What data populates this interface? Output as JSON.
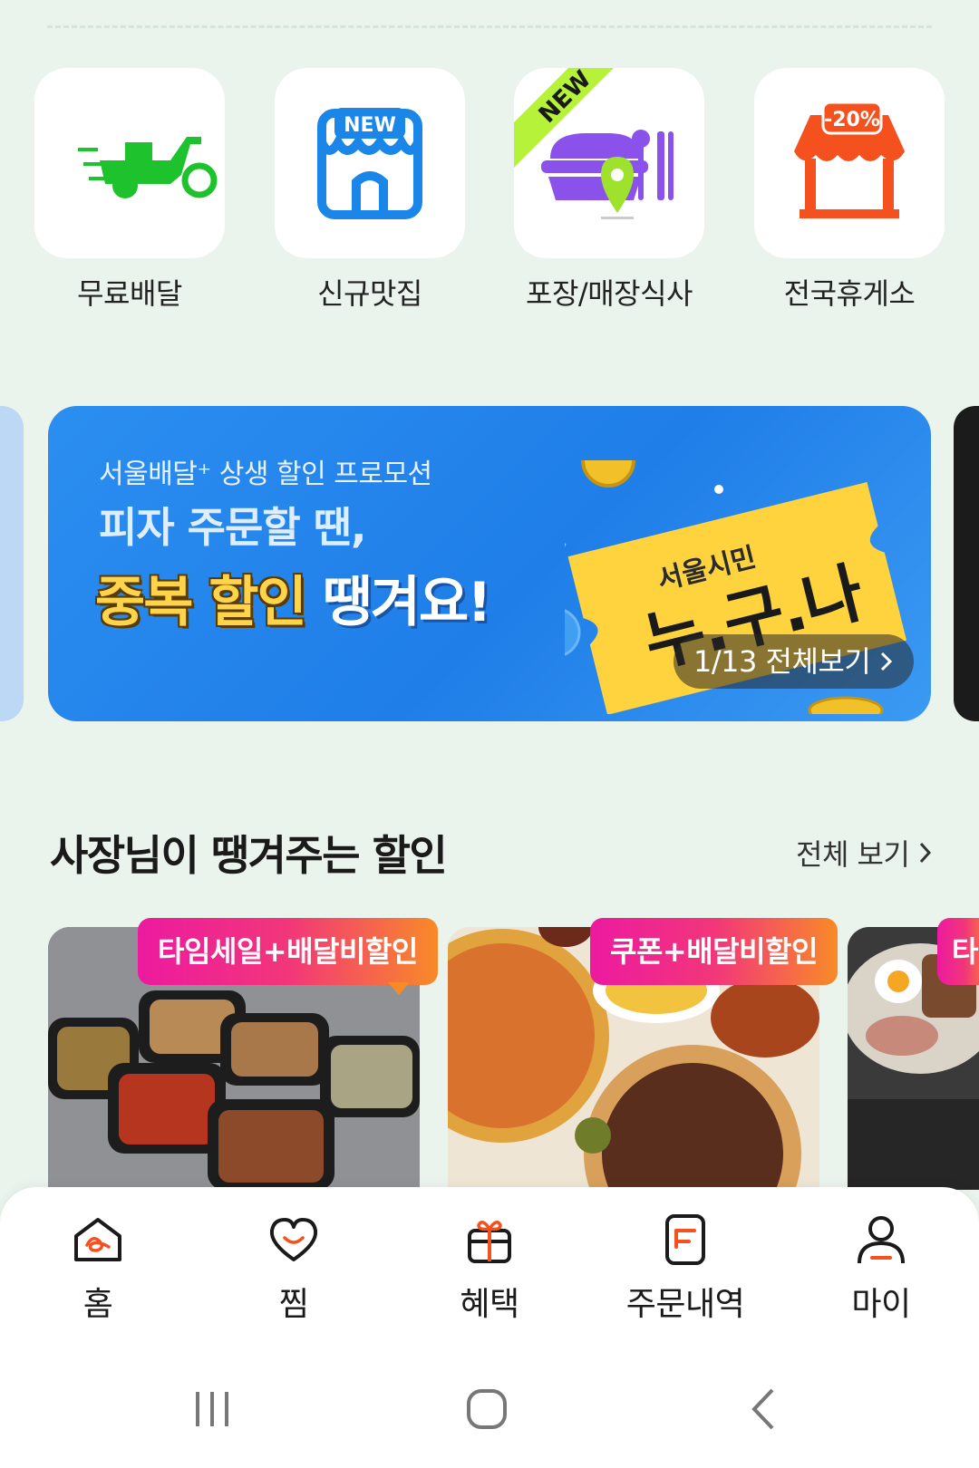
{
  "categories": [
    {
      "label": "무료배달",
      "icon": "scooter-icon"
    },
    {
      "label": "신규맛집",
      "icon": "new-store-icon",
      "badge": "NEW"
    },
    {
      "label": "포장/매장식사",
      "icon": "takeout-icon",
      "ribbon": "NEW"
    },
    {
      "label": "전국휴게소",
      "icon": "rest-area-store-icon",
      "badge": "-20%"
    }
  ],
  "banner": {
    "subtitle": "서울배달⁺ 상생 할인 프로모션",
    "headline1": "피자 주문할 땐,",
    "headline2_gold": "중복 할인",
    "headline2_white": " 땡겨요!",
    "ticket_small": "서울시민",
    "ticket_big": "누.구.나",
    "pager": "1/13 전체보기",
    "colors": {
      "bg": "#2b8ef0",
      "ticket": "#ffd33d"
    }
  },
  "section": {
    "title": "사장님이 땡겨주는 할인",
    "more": "전체 보기"
  },
  "cards": [
    {
      "tag": "타임세일+배달비할인",
      "image": "braised-dishes-photo"
    },
    {
      "tag": "쿠폰+배달비할인",
      "image": "pizza-photo"
    },
    {
      "tag": "타",
      "image": "grill-platter-photo"
    }
  ],
  "nav": [
    {
      "label": "홈",
      "icon": "home-icon"
    },
    {
      "label": "찜",
      "icon": "heart-icon"
    },
    {
      "label": "혜택",
      "icon": "gift-icon"
    },
    {
      "label": "주문내역",
      "icon": "order-history-icon"
    },
    {
      "label": "마이",
      "icon": "profile-icon"
    }
  ],
  "accent_colors": {
    "green": "#1ec22c",
    "blue": "#1a86e8",
    "purple": "#8a52ea",
    "orange": "#f4511e",
    "nav_accent": "#f4511e"
  }
}
